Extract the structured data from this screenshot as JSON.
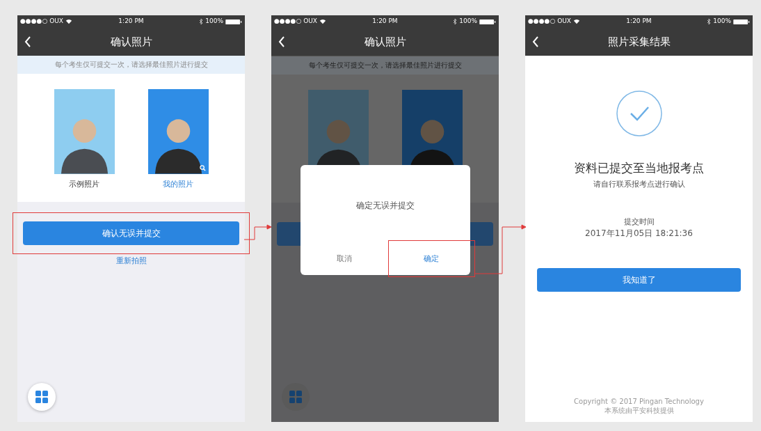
{
  "screens": [
    {
      "kind": "confirm",
      "dimmed": false,
      "status_bar": {
        "carrier": "●●●●○ OUX",
        "time": "1:20 PM",
        "battery": "100%"
      },
      "title": "确认照片",
      "notice": "每个考生仅可提交一次，请选择最佳照片进行提交",
      "photos": [
        {
          "label": "示例照片",
          "selected": false,
          "zoomable": false
        },
        {
          "label": "我的照片",
          "selected": true,
          "zoomable": true
        }
      ],
      "primary_button": {
        "label": "确认无误并提交",
        "highlighted": true
      },
      "secondary_link": "重新拍照"
    },
    {
      "kind": "confirm",
      "dimmed": true,
      "status_bar": {
        "carrier": "●●●●○ OUX",
        "time": "1:20 PM",
        "battery": "100%"
      },
      "title": "确认照片",
      "notice": "每个考生仅可提交一次，请选择最佳照片进行提交",
      "photos": [
        {
          "selected": false
        },
        {
          "selected": true
        }
      ],
      "dialog": {
        "message": "确定无误并提交",
        "buttons": [
          {
            "label": "取消",
            "primary": false,
            "highlighted": false
          },
          {
            "label": "确定",
            "primary": true,
            "highlighted": true
          }
        ]
      }
    },
    {
      "kind": "result",
      "status_bar": {
        "carrier": "●●●●○ OUX",
        "time": "1:20 PM",
        "battery": "100%"
      },
      "title": "照片采集结果",
      "heading": "资料已提交至当地报考点",
      "subheading": "请自行联系报考点进行确认",
      "time_label": "提交时间",
      "time_value": "2017年11月05日 18:21:36",
      "primary_button": {
        "label": "我知道了",
        "highlighted": false
      },
      "footer": [
        "Copyright © 2017 Pingan Technology",
        "本系统由平安科技提供"
      ]
    }
  ]
}
